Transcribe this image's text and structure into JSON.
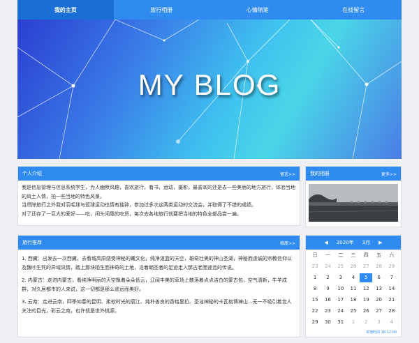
{
  "nav": {
    "items": [
      {
        "label": "我的主页",
        "active": true
      },
      {
        "label": "旅行相册",
        "active": false
      },
      {
        "label": "心情随笔",
        "active": false
      },
      {
        "label": "在线留言",
        "active": false
      }
    ]
  },
  "banner": {
    "title": "MY BLOG"
  },
  "intro": {
    "title": "个人介绍",
    "more": "留言>>",
    "paragraphs": [
      "我是信息管理与信息系统学生，为人幽默风趣，喜欢旅行，看书，运动，摄影。最喜欢的还是去一些美丽的地方旅行，体验当地的风土人情，拍一些当地的特色风景。",
      "当然除旅行之外我对羽毛球与篮球运动也情有独钟，参加过多次这两类运动的交流会，并取得了不错的成绩。",
      "对了还存了一巨大的爱好——吃，闲头闲尾的吃货，每次去各地旅行就要把当地的特色全部品尝一遍。"
    ]
  },
  "recommend": {
    "title": "旅行推荐",
    "more": "相册>>",
    "paragraphs": [
      "1. 西藏：出发去一次西藏，去看城高原感受神秘的藏文化，纯净湛蓝的天空，雄奇壮美的神山圣湖，神秘而虔诚的宗教信仰以及魏吵生死的异域风情，踏上那块陌生而神奇的土地，沿着朝圣者的足迹走入那古老而遥远的传说。",
      "2. 内蒙古：走进内蒙古，看纯净明丽的天空飘着朵朵低云，辽阔丰美的草场上散落着点点洁白的蒙古包，空气清新，牛羊成群，对久居都市的人来说，这一切都是那么遥远而美好。",
      "3. 云南：走进云南，四季如春的昆明、柔软时光的丽江、纯朴善良的香格里拉、圣洁神秘的卡瓦格博神山...无一不吸引着世人关注的目光，彩云之南，也许就是世外桃源。"
    ]
  },
  "album": {
    "title": "我的相册",
    "more": "更多>>"
  },
  "calendar": {
    "prev": "◀",
    "year": "2020年",
    "month": "3月",
    "next": "▶",
    "weekdays": [
      "日",
      "一",
      "二",
      "三",
      "四",
      "五",
      "六"
    ],
    "days": [
      {
        "d": "23",
        "other": true
      },
      {
        "d": "24",
        "other": true
      },
      {
        "d": "25",
        "other": true
      },
      {
        "d": "26",
        "other": true
      },
      {
        "d": "27",
        "other": true
      },
      {
        "d": "28",
        "other": true
      },
      {
        "d": "29",
        "other": true
      },
      {
        "d": "1"
      },
      {
        "d": "2"
      },
      {
        "d": "3"
      },
      {
        "d": "4"
      },
      {
        "d": "5",
        "today": true
      },
      {
        "d": "6"
      },
      {
        "d": "7"
      },
      {
        "d": "8"
      },
      {
        "d": "9"
      },
      {
        "d": "10"
      },
      {
        "d": "11"
      },
      {
        "d": "12"
      },
      {
        "d": "13"
      },
      {
        "d": "14"
      },
      {
        "d": "15"
      },
      {
        "d": "16"
      },
      {
        "d": "17"
      },
      {
        "d": "18"
      },
      {
        "d": "19"
      },
      {
        "d": "20"
      },
      {
        "d": "21"
      },
      {
        "d": "22"
      },
      {
        "d": "23"
      },
      {
        "d": "24"
      },
      {
        "d": "25"
      },
      {
        "d": "26"
      },
      {
        "d": "27"
      },
      {
        "d": "28"
      },
      {
        "d": "29"
      },
      {
        "d": "30"
      },
      {
        "d": "31"
      },
      {
        "d": "1",
        "other": true
      },
      {
        "d": "2",
        "other": true
      },
      {
        "d": "3",
        "other": true
      },
      {
        "d": "4",
        "other": true
      }
    ],
    "footer": "本地时间 18:12:06"
  },
  "colors": {
    "accent": "#2f8bf0",
    "accent_dark": "#1a6fd6"
  }
}
